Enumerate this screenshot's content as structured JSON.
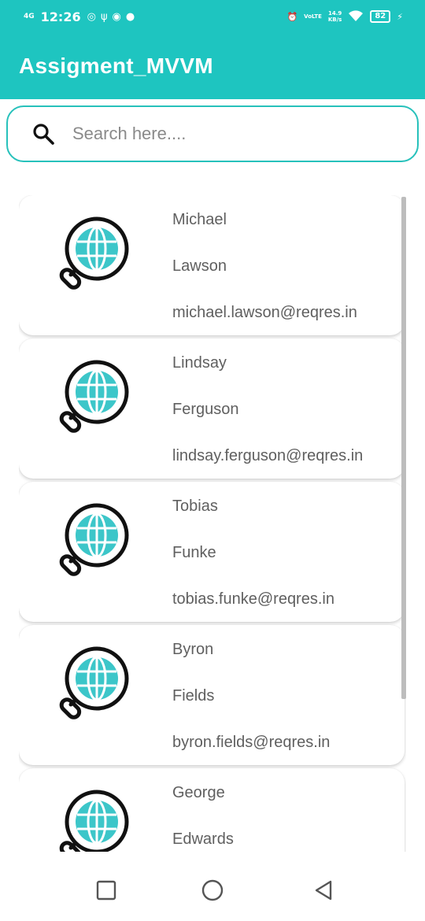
{
  "status_bar": {
    "network": "4G",
    "time": "12:26",
    "speed_top": "14.9",
    "speed_bottom": "KB/s",
    "volte": "VoLTE",
    "battery": "82"
  },
  "app_bar": {
    "title": "Assigment_MVVM"
  },
  "search": {
    "placeholder": "Search here....",
    "value": ""
  },
  "colors": {
    "accent": "#1ec5c0",
    "globe": "#3cc6c9"
  },
  "users": [
    {
      "first_name": "Michael",
      "last_name": "Lawson",
      "email": "michael.lawson@reqres.in"
    },
    {
      "first_name": "Lindsay",
      "last_name": "Ferguson",
      "email": "lindsay.ferguson@reqres.in"
    },
    {
      "first_name": "Tobias",
      "last_name": "Funke",
      "email": "tobias.funke@reqres.in"
    },
    {
      "first_name": "Byron",
      "last_name": "Fields",
      "email": "byron.fields@reqres.in"
    },
    {
      "first_name": "George",
      "last_name": "Edwards",
      "email": ""
    }
  ],
  "nav": {
    "recent_icon": "square-icon",
    "home_icon": "circle-icon",
    "back_icon": "triangle-back-icon"
  }
}
